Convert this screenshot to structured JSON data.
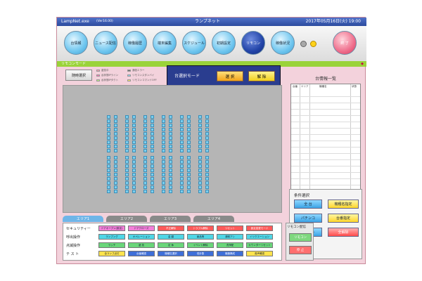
{
  "titlebar": {
    "app": "LampNet.exe",
    "version": "(Ver16.00)",
    "title": "ランプネット",
    "datetime": "2017年05月16日(火) 19:00"
  },
  "nav": {
    "items": [
      "台情報",
      "ニュース配信",
      "稼働履歴",
      "端末編集",
      "スケジュール",
      "初期設定",
      "リモコン",
      "稼働状況"
    ],
    "exit": "終 了"
  },
  "modebar": {
    "title": "リモコンモード"
  },
  "toolbar": {
    "bulk_select": "随時選択"
  },
  "legend": {
    "items": [
      "遊技中",
      "台状態IPライン",
      "台状態IPタクト",
      "通信エラー",
      "リモコンスタンバイ",
      "リモコンコマンドOFF"
    ]
  },
  "mode": {
    "label": "台選択モード",
    "select": "選 択",
    "release": "解 除"
  },
  "areas": [
    "エリア1",
    "エリア2",
    "エリア3",
    "エリア4"
  ],
  "side": {
    "title": "台情報一覧",
    "headers": [
      "台番",
      "エリア",
      "機種名",
      "状態"
    ]
  },
  "filter": {
    "title": "条件選択",
    "all": "全 台",
    "model": "機種名指定",
    "pachinko": "パチンコ",
    "machine": "台番指定",
    "slot": "スロット",
    "clear_all": "全解除"
  },
  "bottom": {
    "rows": [
      "セキュリティー",
      "呼出操作",
      "点滅操作",
      "テ ス ト"
    ],
    "row1": [
      "ドアオープン(設定)",
      "ドアクローズ",
      "不正解除",
      "トラブル解除",
      "リセット",
      "設定変更モード"
    ],
    "row2": [
      "ランプング",
      "オペレーション",
      "金 額",
      "景品等",
      "通常アシ",
      "イリクエーション"
    ],
    "row3": [
      "ラッチ",
      "遊 技",
      "定 休",
      "イベント解除",
      "洗浄配",
      "カウンターリセット"
    ],
    "row4": [
      "全ランプ点灯",
      "台番確認",
      "機種名選択",
      "低計数",
      "機器構成",
      "音声確認"
    ]
  },
  "remote": {
    "title": "リモコン配信",
    "send": "リモコン",
    "stop": "停 止"
  },
  "colors": {
    "title": "#3a5bb8",
    "accent": "#9ad33a",
    "pink": "#f3d2dc"
  }
}
